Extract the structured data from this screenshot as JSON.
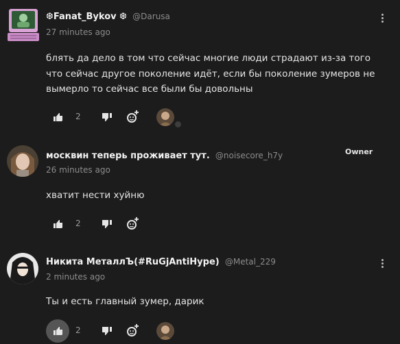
{
  "comments": [
    {
      "name": "❆Fanat_Bykov ❆",
      "handle": "@Darusa",
      "time": "27 minutes ago",
      "text": "блять да дело в том что сейчас многие люди страдают из-за того что сейчас другое поколение идёт, если бы поколение зумеров не вымерло то сейчас все были бы довольны",
      "likes": "2"
    },
    {
      "name": "москвин теперь проживает тут.",
      "handle": "@noisecore_h7y",
      "time": "26 minutes ago",
      "text": "хватит нести хуйню",
      "likes": "2",
      "badge": "Owner"
    },
    {
      "name": "Никита МеталлЪ(#RuGjAntiHype)",
      "handle": "@Metal_229",
      "time": "2 minutes ago",
      "text": "Ты и есть главный зумер, дарик",
      "likes": "2"
    }
  ],
  "icons": {
    "like": "thumbs-up-icon",
    "dislike": "thumbs-down-icon",
    "reply": "add-reaction-icon",
    "menu": "more-vertical-icon"
  },
  "colors": {
    "background": "#1c1c1c",
    "text": "#e6e6e6",
    "muted": "#8c8c8c"
  }
}
